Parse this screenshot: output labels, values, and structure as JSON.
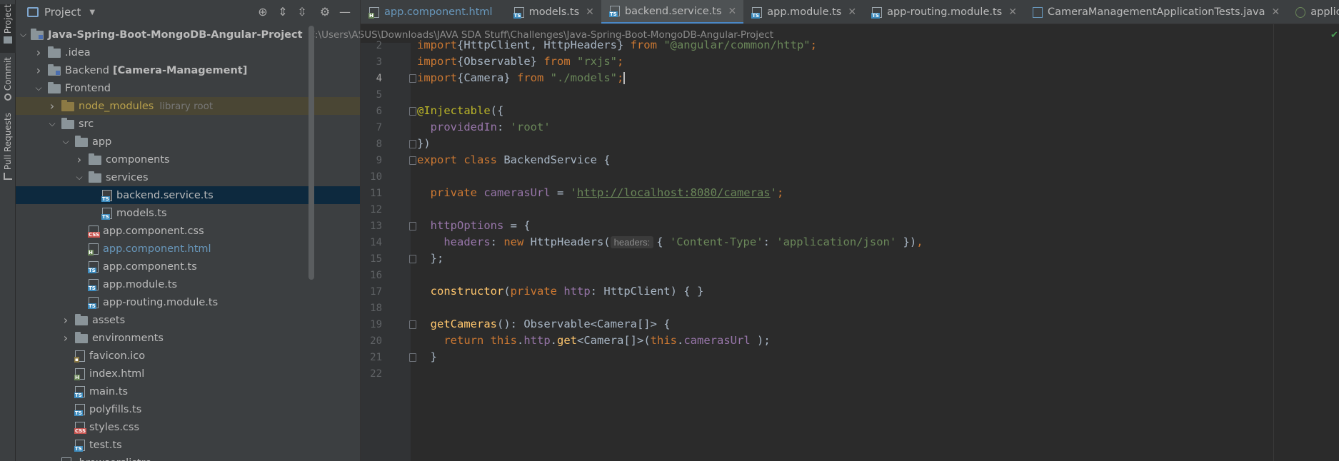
{
  "toolstrip": {
    "project_label": "Project",
    "commit_label": "Commit",
    "pull_requests_label": "Pull Requests"
  },
  "panel": {
    "title": "Project",
    "buttons": [
      "locate-icon",
      "expand-all-icon",
      "collapse-all-icon",
      "gear-icon",
      "minimize-icon"
    ]
  },
  "tree": [
    {
      "level": 0,
      "arrow": "open",
      "icon": "module-folder",
      "label": "Java-Spring-Boot-MongoDB-Angular-Project",
      "bold": true,
      "sub": "C:\\Users\\ASUS\\Downloads\\JAVA SDA Stuff\\Challenges\\Java-Spring-Boot-MongoDB-Angular-Project"
    },
    {
      "level": 1,
      "arrow": "closed",
      "icon": "folder",
      "label": ".idea"
    },
    {
      "level": 1,
      "arrow": "closed",
      "icon": "module-folder",
      "label": "Backend",
      "bold_suffix": "[Camera-Management]"
    },
    {
      "level": 1,
      "arrow": "open",
      "icon": "folder",
      "label": "Frontend"
    },
    {
      "level": 2,
      "arrow": "closed",
      "icon": "excluded-folder",
      "label": "node_modules",
      "sub": "library root",
      "highlight": true
    },
    {
      "level": 2,
      "arrow": "open",
      "icon": "folder",
      "label": "src"
    },
    {
      "level": 3,
      "arrow": "open",
      "icon": "folder",
      "label": "app"
    },
    {
      "level": 4,
      "arrow": "closed",
      "icon": "folder",
      "label": "components"
    },
    {
      "level": 4,
      "arrow": "open",
      "icon": "folder",
      "label": "services"
    },
    {
      "level": 5,
      "arrow": "none",
      "icon": "ts",
      "label": "backend.service.ts",
      "selected": true
    },
    {
      "level": 5,
      "arrow": "none",
      "icon": "ts",
      "label": "models.ts"
    },
    {
      "level": 4,
      "arrow": "none",
      "icon": "css",
      "label": "app.component.css"
    },
    {
      "level": 4,
      "arrow": "none",
      "icon": "html",
      "label": "app.component.html",
      "modified": true
    },
    {
      "level": 4,
      "arrow": "none",
      "icon": "ts",
      "label": "app.component.ts"
    },
    {
      "level": 4,
      "arrow": "none",
      "icon": "ts",
      "label": "app.module.ts"
    },
    {
      "level": 4,
      "arrow": "none",
      "icon": "ts",
      "label": "app-routing.module.ts"
    },
    {
      "level": 3,
      "arrow": "closed",
      "icon": "folder",
      "label": "assets"
    },
    {
      "level": 3,
      "arrow": "closed",
      "icon": "folder",
      "label": "environments"
    },
    {
      "level": 3,
      "arrow": "none",
      "icon": "ico",
      "label": "favicon.ico"
    },
    {
      "level": 3,
      "arrow": "none",
      "icon": "html",
      "label": "index.html"
    },
    {
      "level": 3,
      "arrow": "none",
      "icon": "ts",
      "label": "main.ts"
    },
    {
      "level": 3,
      "arrow": "none",
      "icon": "ts",
      "label": "polyfills.ts"
    },
    {
      "level": 3,
      "arrow": "none",
      "icon": "css",
      "label": "styles.css"
    },
    {
      "level": 3,
      "arrow": "none",
      "icon": "ts",
      "label": "test.ts"
    },
    {
      "level": 2,
      "arrow": "none",
      "icon": "file",
      "label": ".browserslistrc"
    }
  ],
  "tabs": [
    {
      "label": "app.component.html",
      "icon": "html",
      "modified": true,
      "close": false
    },
    {
      "label": "models.ts",
      "icon": "ts",
      "close": true
    },
    {
      "label": "backend.service.ts",
      "icon": "ts",
      "active": true,
      "close": true
    },
    {
      "label": "app.module.ts",
      "icon": "ts",
      "close": true
    },
    {
      "label": "app-routing.module.ts",
      "icon": "ts",
      "close": true
    },
    {
      "label": "CameraManagementApplicationTests.java",
      "icon": "java",
      "close": true
    },
    {
      "label": "application.pr",
      "icon": "spring",
      "close": false
    }
  ],
  "editor": {
    "current_line": 4,
    "lines": [
      {
        "n": 2,
        "tokens": [
          [
            "kw",
            "import"
          ],
          [
            "",
            "{HttpClient, HttpHeaders} "
          ],
          [
            "kw",
            "from "
          ],
          [
            "str",
            "\"@angular/common/http\""
          ],
          [
            "kw",
            ";"
          ]
        ]
      },
      {
        "n": 3,
        "tokens": [
          [
            "kw",
            "import"
          ],
          [
            "",
            "{Observable} "
          ],
          [
            "kw",
            "from "
          ],
          [
            "str",
            "\"rxjs\""
          ],
          [
            "kw",
            ";"
          ]
        ]
      },
      {
        "n": 4,
        "fold": true,
        "tokens": [
          [
            "kw",
            "import"
          ],
          [
            "",
            "{Camera} "
          ],
          [
            "kw",
            "from "
          ],
          [
            "str",
            "\"./models\""
          ],
          [
            "kw",
            ";"
          ]
        ]
      },
      {
        "n": 5,
        "tokens": []
      },
      {
        "n": 6,
        "fold": true,
        "tokens": [
          [
            "ann",
            "@Injectable"
          ],
          [
            "",
            "({"
          ]
        ]
      },
      {
        "n": 7,
        "tokens": [
          [
            "",
            "  "
          ],
          [
            "fld",
            "providedIn"
          ],
          [
            "",
            ": "
          ],
          [
            "str",
            "'root'"
          ]
        ]
      },
      {
        "n": 8,
        "fold": true,
        "tokens": [
          [
            "",
            "})"
          ]
        ]
      },
      {
        "n": 9,
        "fold": true,
        "tokens": [
          [
            "kw",
            "export class "
          ],
          [
            "",
            "BackendService {"
          ]
        ]
      },
      {
        "n": 10,
        "tokens": []
      },
      {
        "n": 11,
        "tokens": [
          [
            "",
            "  "
          ],
          [
            "kw",
            "private "
          ],
          [
            "fld",
            "camerasUrl"
          ],
          [
            "",
            " = "
          ],
          [
            "str",
            "'"
          ],
          [
            "link",
            "http://localhost:8080/cameras"
          ],
          [
            "str",
            "'"
          ],
          [
            "kw",
            ";"
          ]
        ]
      },
      {
        "n": 12,
        "tokens": []
      },
      {
        "n": 13,
        "fold": true,
        "tokens": [
          [
            "",
            "  "
          ],
          [
            "fld",
            "httpOptions"
          ],
          [
            "",
            " = {"
          ]
        ]
      },
      {
        "n": 14,
        "tokens": [
          [
            "",
            "    "
          ],
          [
            "fld",
            "headers"
          ],
          [
            "",
            ": "
          ],
          [
            "kw",
            "new "
          ],
          [
            "",
            "HttpHeaders("
          ],
          [
            "hint",
            "headers:"
          ],
          [
            "",
            "{ "
          ],
          [
            "str",
            "'Content-Type'"
          ],
          [
            "",
            ": "
          ],
          [
            "str",
            "'application/json'"
          ],
          [
            "",
            " })"
          ],
          [
            "kw",
            ","
          ]
        ]
      },
      {
        "n": 15,
        "fold": true,
        "tokens": [
          [
            "",
            "  };"
          ]
        ]
      },
      {
        "n": 16,
        "tokens": []
      },
      {
        "n": 17,
        "tokens": [
          [
            "",
            "  "
          ],
          [
            "fn",
            "constructor"
          ],
          [
            "",
            "("
          ],
          [
            "kw",
            "private "
          ],
          [
            "fld",
            "http"
          ],
          [
            "",
            ": HttpClient) { }"
          ]
        ]
      },
      {
        "n": 18,
        "tokens": []
      },
      {
        "n": 19,
        "fold": true,
        "tokens": [
          [
            "",
            "  "
          ],
          [
            "fn",
            "getCameras"
          ],
          [
            "",
            "(): Observable<Camera[]> {"
          ]
        ]
      },
      {
        "n": 20,
        "tokens": [
          [
            "",
            "    "
          ],
          [
            "kw",
            "return this"
          ],
          [
            "",
            "."
          ],
          [
            "fld",
            "http"
          ],
          [
            "",
            "."
          ],
          [
            "fn",
            "get"
          ],
          [
            "",
            "<Camera[]>("
          ],
          [
            "kw",
            "this"
          ],
          [
            "",
            "."
          ],
          [
            "fld",
            "camerasUrl"
          ],
          [
            "",
            " );"
          ]
        ]
      },
      {
        "n": 21,
        "fold": true,
        "tokens": [
          [
            "",
            "  }"
          ]
        ]
      },
      {
        "n": 22,
        "tokens": []
      }
    ]
  },
  "colors": {
    "background": "#2b2b2b",
    "panel": "#3c3f41",
    "selection": "#0d293e",
    "keyword": "#cc7832",
    "string": "#6a8759",
    "field": "#9876aa",
    "function": "#ffc66d",
    "annotation": "#bbb529"
  }
}
